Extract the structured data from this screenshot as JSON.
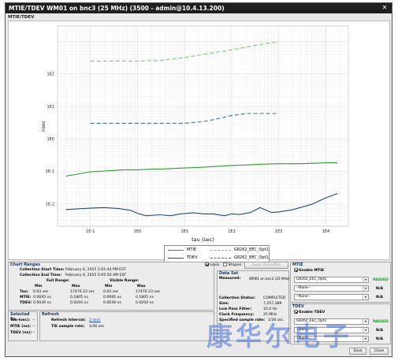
{
  "window": {
    "title": "MTIE/TDEV WM01 on bnc3 (25 MHz) (3500 - admin@10.4.13.200)",
    "close_label": "✕"
  },
  "section_label": "MTIE/TDEV",
  "chart_data": {
    "type": "line",
    "xscale": "log",
    "yscale": "log",
    "xlabel": "tau (sec)",
    "ylabel": "nsec",
    "xlim": [
      0.02,
      30000
    ],
    "ylim": [
      0.002,
      3000
    ],
    "x_tick_labels": [
      "1E-1",
      "1E0",
      "1E1",
      "1E2",
      "1E3",
      "1E4"
    ],
    "x_ticks": [
      0.1,
      1,
      10,
      100,
      1000,
      10000
    ],
    "y_tick_labels": [
      "1E2",
      "1E1",
      "1E0",
      "1E-1",
      "1E-2"
    ],
    "y_ticks": [
      100,
      10,
      1,
      0.1,
      0.01
    ],
    "grid": true,
    "series": [
      {
        "name": "MTIE",
        "color": "#2f9a2f",
        "style": "solid",
        "x": [
          0.03,
          0.1,
          0.2,
          0.3,
          0.5,
          1,
          2,
          3,
          5,
          10,
          20,
          30,
          50,
          100,
          200,
          300,
          500,
          1000,
          3000,
          10000,
          17476
        ],
        "y": [
          0.07,
          0.095,
          0.1,
          0.105,
          0.11,
          0.11,
          0.115,
          0.115,
          0.12,
          0.125,
          0.13,
          0.135,
          0.14,
          0.15,
          0.155,
          0.16,
          0.165,
          0.17,
          0.17,
          0.18,
          0.1805
        ]
      },
      {
        "name": "G8262_EEC_Opt1",
        "color": "#6fce6f",
        "style": "dashed",
        "x": [
          0.1,
          1,
          3,
          10,
          30,
          100,
          300,
          1000
        ],
        "y": [
          250,
          250,
          260,
          320,
          420,
          550,
          750,
          1000
        ]
      },
      {
        "name": "TDEV",
        "color": "#1f4a7a",
        "style": "solid",
        "x": [
          0.03,
          0.07,
          0.1,
          0.2,
          0.4,
          0.7,
          1,
          1.5,
          3,
          5,
          8,
          15,
          25,
          40,
          70,
          100,
          150,
          250,
          400,
          700,
          1000,
          2000,
          5000,
          10000,
          17476
        ],
        "y": [
          0.0065,
          0.007,
          0.0072,
          0.0075,
          0.007,
          0.0062,
          0.005,
          0.0042,
          0.0045,
          0.0042,
          0.0048,
          0.0052,
          0.0048,
          0.0048,
          0.0042,
          0.0048,
          0.0046,
          0.0053,
          0.0075,
          0.0053,
          0.0055,
          0.0065,
          0.0095,
          0.015,
          0.0204
        ]
      },
      {
        "name": "G8262_EEC_Opt1",
        "color": "#3b6fb6",
        "style": "dashed",
        "x": [
          0.1,
          1,
          10,
          30,
          100,
          200,
          500,
          1000
        ],
        "y": [
          3,
          3,
          3,
          3.5,
          5.2,
          6,
          6,
          6
        ]
      }
    ]
  },
  "legend": {
    "mtie_label": "MTIE",
    "mtie_mask_label": "G8262_EEC_Opt1",
    "tdev_label": "TDEV",
    "tdev_mask_label": "G8262_EEC_Opt1"
  },
  "chart_ranges": {
    "title": "Chart Ranges",
    "start_label": "Collection Start Time:",
    "start_value": "February 6, 2015 1:01:44 PM EST",
    "end_label": "Collection End Time:",
    "end_value": "February 6, 2015 5:05:50 AM EST",
    "full_range_label": "Full Range:",
    "visible_range_label": "Visible Range:",
    "min_label": "Min",
    "max_label": "Max",
    "rows": [
      {
        "label": "Tau:",
        "full_min": "0.03 sec",
        "full_max": "17476.23 sec",
        "vis_min": "0.03 sec",
        "vis_max": "17476.23 sec"
      },
      {
        "label": "MTIE:",
        "full_min": "0.0695 ns",
        "full_max": "0.1805 ns",
        "vis_min": "0.0695 ns",
        "vis_max": "0.1805 ns"
      },
      {
        "label": "TDEV:",
        "full_min": "0.0039 ns",
        "full_max": "0.0204 ns",
        "vis_min": "0.0039 ns",
        "vis_max": "0.0204 ns"
      }
    ]
  },
  "selected": {
    "title": "Selected Sa...",
    "tau_label": "Tau (sec):",
    "tau_value": "--",
    "mtie_label": "MTIE (ns):",
    "mtie_value": "--",
    "tdev_label": "TDEV (ns):",
    "tdev_value": "--"
  },
  "refresh": {
    "title": "Refresh",
    "interval_label": "Refresh Interval:",
    "interval_value": "5 secs",
    "rate_label": "TIE sample rate:",
    "rate_value": "1/30 sec"
  },
  "toolbar": {
    "lines_label": "Lines",
    "lines_checked": true,
    "shapes_label": "Shapes",
    "shapes_checked": false,
    "reset_label": "Reset Zoom/Pan"
  },
  "data_set": {
    "title": "Data Set",
    "measured_label": "Measured:",
    "measured_value": "WM01 on bnc3 (25 MHz)",
    "status_label": "Collection Status:",
    "status_value": "COMPLETED",
    "size_label": "Size:",
    "size_value": "7,257,389",
    "lpf_label": "Low Pass Filter:",
    "lpf_value": "10.0 Hz",
    "clock_label": "Clock Frequency:",
    "clock_value": "25 MHz",
    "rate_label": "Specified sample rate:",
    "rate_value": "1/30 sec"
  },
  "mtie_panel": {
    "title": "MTIE",
    "enable_label": "Enable MTIE",
    "enabled": true,
    "mask1_value": "G8262_EEC_Opt1",
    "mask1_result": "PASSED",
    "mask2_value": "--None--",
    "mask2_result": "N/A",
    "mask3_value": "--None--",
    "mask3_result": "N/A"
  },
  "tdev_panel": {
    "title": "TDEV",
    "enable_label": "Enable TDEV",
    "enabled": true,
    "mask1_value": "G8262_EEC_Opt1",
    "mask1_result": "PASSED",
    "mask2_value": "--None--",
    "mask2_result": "N/A",
    "mask3_value": "--None--",
    "mask3_result": "N/A"
  },
  "footer": {
    "save_label": "Save",
    "close_label": "Close"
  },
  "watermark_text": "康华尔电子"
}
